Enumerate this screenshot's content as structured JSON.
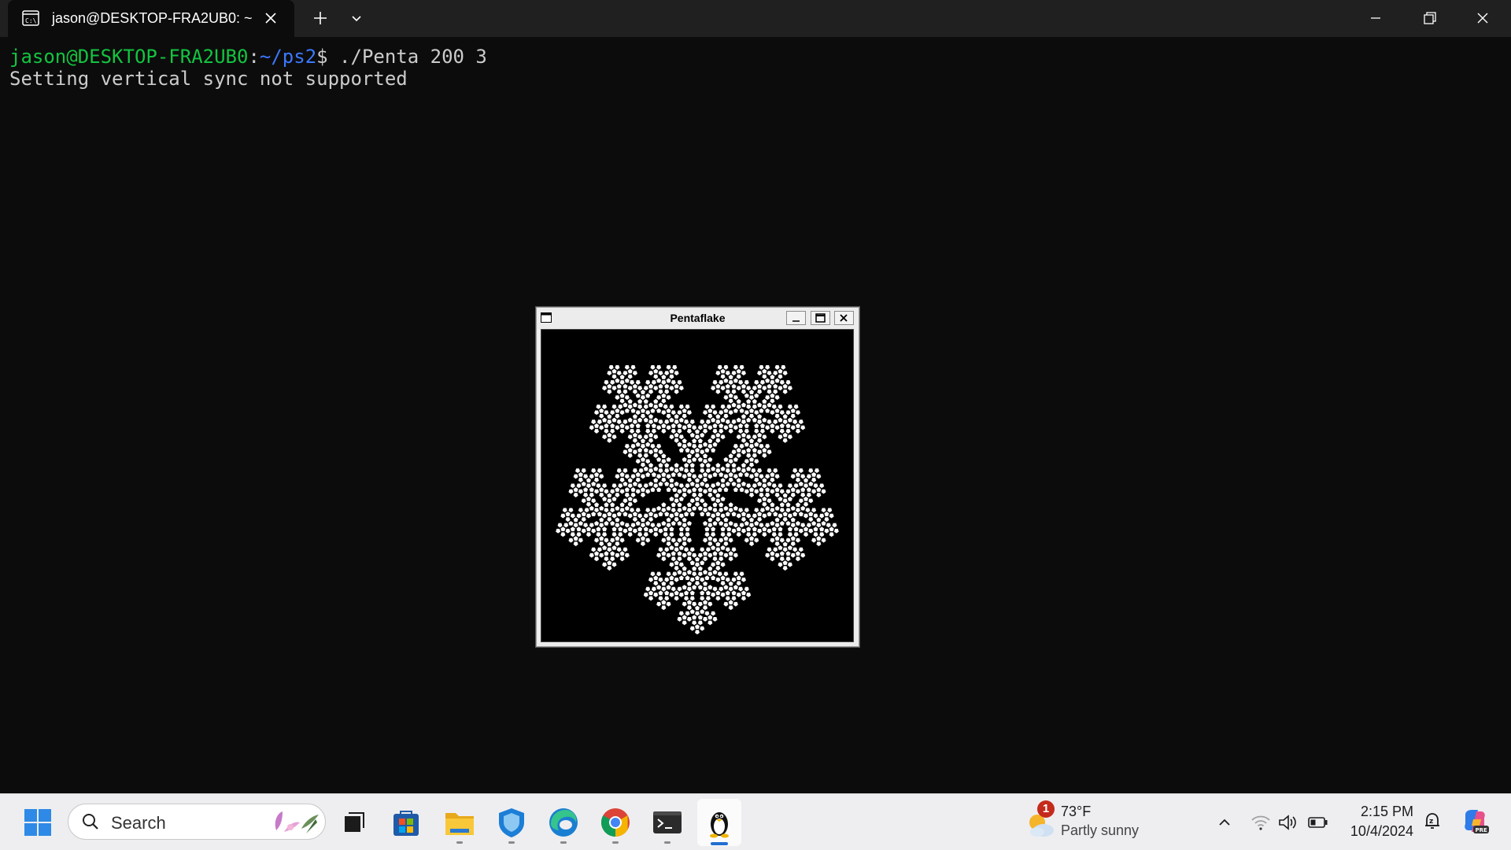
{
  "terminal": {
    "tab_title": "jason@DESKTOP-FRA2UB0: ~",
    "lines": {
      "prompt_user": "jason@DESKTOP-FRA2UB0",
      "prompt_colon": ":",
      "prompt_path": "~/ps2",
      "prompt_dollar": "$",
      "command": " ./Penta 200 3",
      "output": "Setting vertical sync not supported"
    }
  },
  "xwindow": {
    "title": "Pentaflake",
    "canvas_background": "#000000",
    "flake_color": "#ffffff",
    "fractal_depth": 3,
    "size_argument": 200
  },
  "taskbar": {
    "search_placeholder": "Search",
    "pinned_icons": [
      "windows-start-icon",
      "task-view-icon",
      "microsoft-store-icon",
      "file-explorer-icon",
      "defender-icon",
      "edge-icon",
      "chrome-icon",
      "terminal-icon",
      "linux-tux-icon"
    ],
    "weather": {
      "badge": "1",
      "temperature": "73°F",
      "condition": "Partly sunny"
    },
    "clock": {
      "time": "2:15 PM",
      "date": "10/4/2024"
    },
    "accent": "#1f6fd1"
  },
  "colors": {
    "terminal_bg": "#0c0c0c",
    "prompt_user": "#13c440",
    "prompt_path": "#3b78ff",
    "text": "#cccccc"
  }
}
